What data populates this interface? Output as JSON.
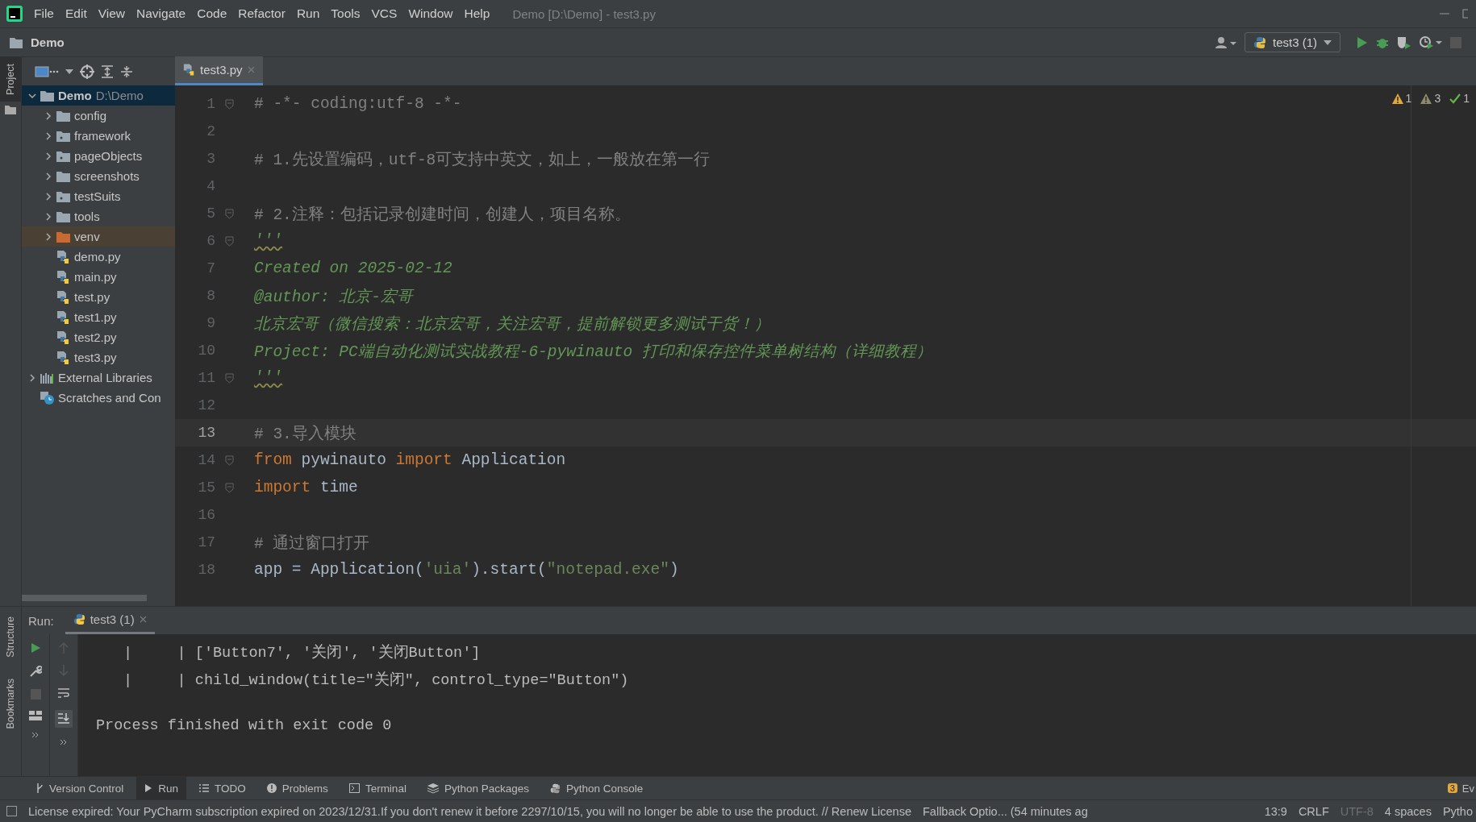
{
  "menu": [
    "File",
    "Edit",
    "View",
    "Navigate",
    "Code",
    "Refactor",
    "Run",
    "Tools",
    "VCS",
    "Window",
    "Help"
  ],
  "window": {
    "title": "Demo [D:\\Demo] - test3.py"
  },
  "breadcrumb": "Demo",
  "run_config": "test3 (1)",
  "side_tabs": {
    "top": "Project",
    "structure": "Structure",
    "bookmarks": "Bookmarks"
  },
  "editor_tabs": [
    {
      "label": "test3.py",
      "selected": true
    }
  ],
  "tree": [
    {
      "label": "Demo",
      "path": "D:\\Demo",
      "kind": "folder",
      "expanded": true,
      "selected": true,
      "children": [
        {
          "label": "config",
          "kind": "folder",
          "expanded": false,
          "selected": false
        },
        {
          "label": "framework",
          "kind": "package",
          "expanded": false,
          "selected": false
        },
        {
          "label": "pageObjects",
          "kind": "package",
          "expanded": false,
          "selected": false
        },
        {
          "label": "screenshots",
          "kind": "folder",
          "expanded": false,
          "selected": false
        },
        {
          "label": "testSuits",
          "kind": "package",
          "expanded": false,
          "selected": false
        },
        {
          "label": "tools",
          "kind": "folder",
          "expanded": false,
          "selected": false
        },
        {
          "label": "venv",
          "kind": "excluded",
          "expanded": false,
          "selected": false
        },
        {
          "label": "demo.py",
          "kind": "file",
          "selected": false
        },
        {
          "label": "main.py",
          "kind": "file",
          "selected": false
        },
        {
          "label": "test.py",
          "kind": "file",
          "selected": false
        },
        {
          "label": "test1.py",
          "kind": "file",
          "selected": false
        },
        {
          "label": "test2.py",
          "kind": "file",
          "selected": false
        },
        {
          "label": "test3.py",
          "kind": "file",
          "selected": false
        }
      ]
    },
    {
      "label": "External Libraries",
      "kind": "library",
      "expanded": false,
      "selected": false
    },
    {
      "label": "Scratches and Con",
      "kind": "scratches",
      "selected": false
    }
  ],
  "inspections": [
    {
      "kind": "warning",
      "count": "1"
    },
    {
      "kind": "weak",
      "count": "3"
    },
    {
      "kind": "ok",
      "count": "1"
    }
  ],
  "code": [
    {
      "number": "1",
      "fold": true,
      "current": false,
      "tokens": [
        {
          "kind": "comment",
          "text": "# -*- coding:utf-8 -*-"
        }
      ]
    },
    {
      "number": "2",
      "fold": false,
      "current": false
    },
    {
      "number": "3",
      "fold": false,
      "current": false,
      "tokens": [
        {
          "kind": "comment",
          "text": "# 1.先设置编码，utf-8可支持中英文，如上，一般放在第一行"
        }
      ]
    },
    {
      "number": "4",
      "fold": false,
      "current": false
    },
    {
      "number": "5",
      "fold": true,
      "current": false,
      "tokens": [
        {
          "kind": "comment",
          "text": "# 2.注释：包括记录创建时间，创建人，项目名称。"
        }
      ]
    },
    {
      "number": "6",
      "fold": true,
      "current": false,
      "tokens": [
        {
          "kind": "quote",
          "text": "'''"
        }
      ]
    },
    {
      "number": "7",
      "fold": false,
      "current": false,
      "tokens": [
        {
          "kind": "docstring",
          "text": "Created on 2025-02-12"
        }
      ]
    },
    {
      "number": "8",
      "fold": false,
      "current": false,
      "tokens": [
        {
          "kind": "docstring",
          "text": "@author: 北京-宏哥"
        }
      ]
    },
    {
      "number": "9",
      "fold": false,
      "current": false,
      "tokens": [
        {
          "kind": "docstring",
          "text": "北京宏哥（微信搜索：北京宏哥，关注宏哥，提前解锁更多测试干货！）"
        }
      ]
    },
    {
      "number": "10",
      "fold": false,
      "current": false,
      "tokens": [
        {
          "kind": "docstring",
          "text": "Project: PC端自动化测试实战教程-6-pywinauto 打印和保存控件菜单树结构（详细教程）"
        }
      ]
    },
    {
      "number": "11",
      "fold": true,
      "current": false,
      "tokens": [
        {
          "kind": "quote",
          "text": "'''"
        }
      ]
    },
    {
      "number": "12",
      "fold": false,
      "current": false
    },
    {
      "number": "13",
      "fold": false,
      "current": true,
      "tokens": [
        {
          "kind": "comment",
          "text": "# 3.导入模块"
        }
      ]
    },
    {
      "number": "14",
      "fold": true,
      "current": false,
      "tokens": [
        {
          "kind": "keyword",
          "text": "from"
        },
        {
          "kind": "plain",
          "text": " pywinauto "
        },
        {
          "kind": "keyword",
          "text": "import"
        },
        {
          "kind": "plain",
          "text": " Application"
        }
      ]
    },
    {
      "number": "15",
      "fold": true,
      "current": false,
      "tokens": [
        {
          "kind": "keyword",
          "text": "import"
        },
        {
          "kind": "plain",
          "text": " time"
        }
      ]
    },
    {
      "number": "16",
      "fold": false,
      "current": false
    },
    {
      "number": "17",
      "fold": false,
      "current": false,
      "tokens": [
        {
          "kind": "comment",
          "text": "# 通过窗口打开"
        }
      ]
    },
    {
      "number": "18",
      "fold": false,
      "current": false,
      "tokens": [
        {
          "kind": "plain",
          "text": "app = Application("
        },
        {
          "kind": "string",
          "text": "'uia'"
        },
        {
          "kind": "plain",
          "text": ").start("
        },
        {
          "kind": "string",
          "text": "\"notepad.exe\""
        },
        {
          "kind": "plain",
          "text": ")"
        }
      ]
    }
  ],
  "run": {
    "label": "Run:",
    "tabs": [
      {
        "label": "test3 (1)",
        "selected": true
      }
    ],
    "output": [
      {
        "kind": "trace",
        "text": "|     | ['Button7', '关闭', '关闭Button']"
      },
      {
        "kind": "trace",
        "text": "|     | child_window(title=\"关闭\", control_type=\"Button\")"
      },
      {
        "kind": "exit",
        "text": "Process finished with exit code 0"
      }
    ]
  },
  "tool_tabs": [
    {
      "label": "Version Control",
      "kind": "vcs",
      "selected": false
    },
    {
      "label": "Run",
      "kind": "run",
      "selected": true
    },
    {
      "label": "TODO",
      "kind": "todo",
      "selected": false
    },
    {
      "label": "Problems",
      "kind": "problems",
      "selected": false
    },
    {
      "label": "Terminal",
      "kind": "terminal",
      "selected": false
    },
    {
      "label": "Python Packages",
      "kind": "packages",
      "selected": false
    },
    {
      "label": "Python Console",
      "kind": "console",
      "selected": false
    }
  ],
  "event_log": {
    "badge": "3",
    "label": "Ev"
  },
  "status": {
    "message": "License expired: Your PyCharm subscription expired on 2023/12/31.If you don't renew it before 2297/10/15, you will no longer be able to use the product. // Renew License",
    "fallback": "Fallback Optio... (54 minutes ag",
    "items": [
      {
        "label": "13:9",
        "disabled": false
      },
      {
        "label": "CRLF",
        "disabled": false
      },
      {
        "label": "UTF-8",
        "disabled": true
      },
      {
        "label": "4 spaces",
        "disabled": false
      },
      {
        "label": "Pytho",
        "disabled": false
      }
    ]
  }
}
